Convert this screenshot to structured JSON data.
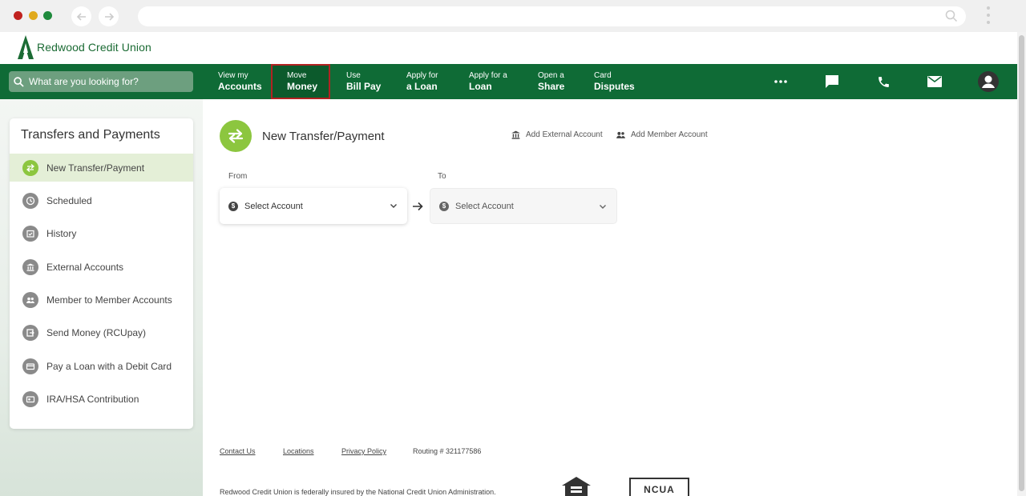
{
  "brand": {
    "name": "Redwood Credit Union",
    "green": "#0f6b36",
    "accent": "#8cc63f"
  },
  "search": {
    "placeholder": "What are you looking for?"
  },
  "nav": {
    "items": [
      {
        "line1": "View my",
        "line2": "Accounts"
      },
      {
        "line1": "Move",
        "line2": "Money"
      },
      {
        "line1": "Use",
        "line2": "Bill Pay"
      },
      {
        "line1": "Apply for",
        "line2": "a Loan"
      },
      {
        "line1": "Apply for a",
        "line2": "Loan"
      },
      {
        "line1": "Open a",
        "line2": "Share"
      },
      {
        "line1": "Card",
        "line2": "Disputes"
      }
    ],
    "icons": [
      "more-icon",
      "chat-icon",
      "phone-icon",
      "mail-icon",
      "account-icon"
    ]
  },
  "sidebar": {
    "title": "Transfers and Payments",
    "items": [
      {
        "label": "New Transfer/Payment",
        "icon": "transfer-icon"
      },
      {
        "label": "Scheduled",
        "icon": "clock-icon"
      },
      {
        "label": "History",
        "icon": "calendar-check-icon"
      },
      {
        "label": "External Accounts",
        "icon": "bank-icon"
      },
      {
        "label": "Member to Member Accounts",
        "icon": "people-icon"
      },
      {
        "label": "Send Money (RCUpay)",
        "icon": "send-money-icon"
      },
      {
        "label": "Pay a Loan with a Debit Card",
        "icon": "card-icon"
      },
      {
        "label": "IRA/HSA Contribution",
        "icon": "contribution-icon"
      }
    ]
  },
  "main": {
    "title": "New Transfer/Payment",
    "add_external": "Add External Account",
    "add_member": "Add Member Account",
    "from_label": "From",
    "to_label": "To",
    "from_value": "Select Account",
    "to_value": "Select Account"
  },
  "footer": {
    "contact": "Contact Us",
    "locations": "Locations",
    "privacy": "Privacy Policy",
    "routing": "Routing # 321177586",
    "disclaimer": "Redwood Credit Union is federally insured by the National Credit Union Administration.",
    "ncua": "NCUA"
  }
}
